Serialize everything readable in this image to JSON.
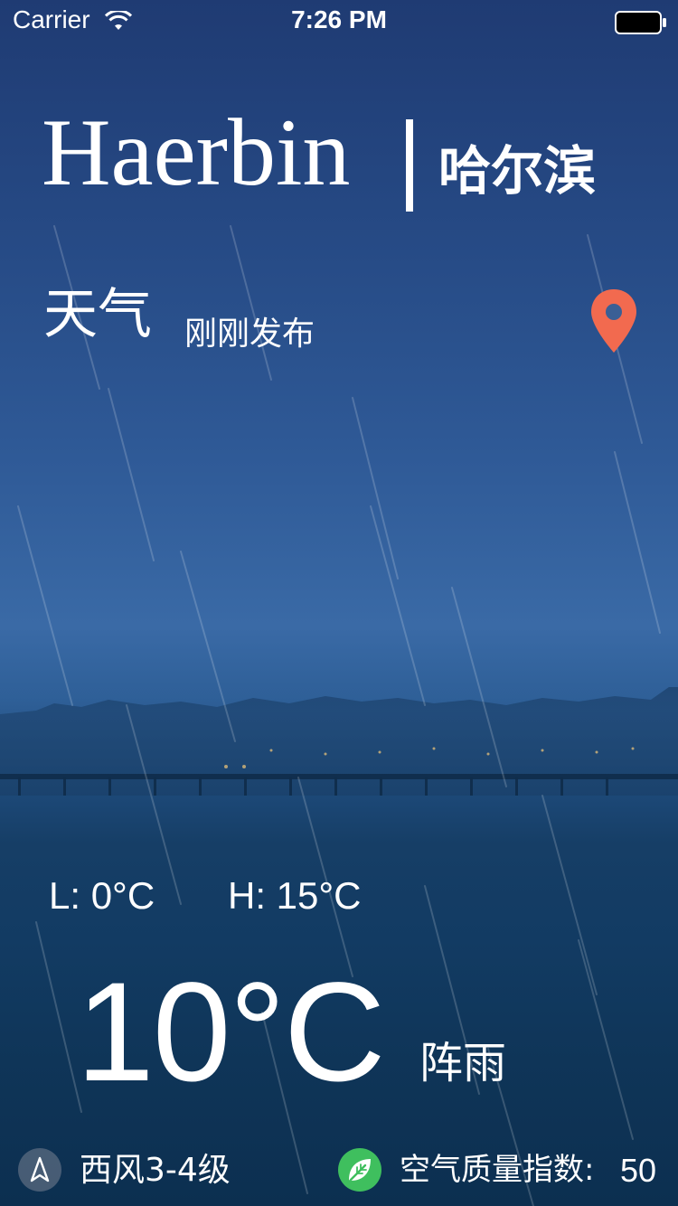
{
  "status_bar": {
    "carrier": "Carrier",
    "time": "7:26 PM",
    "icons": [
      "wifi-icon",
      "battery-icon"
    ]
  },
  "header": {
    "city_en": "Haerbin",
    "city_zh": "哈尔滨"
  },
  "weather": {
    "label": "天气",
    "publish_time": "刚刚发布",
    "low": "L: 0°C",
    "high": "H: 15°C",
    "current_temp": "10°C",
    "condition": "阵雨"
  },
  "footer": {
    "wind": "西风3-4级",
    "aqi_label": "空气质量指数:",
    "aqi_value": "50",
    "icons": [
      "wind-direction-icon",
      "leaf-icon"
    ]
  },
  "colors": {
    "location_pin": "#f26a4f",
    "aqi_badge": "#3fbf5e",
    "text": "#ffffff"
  }
}
